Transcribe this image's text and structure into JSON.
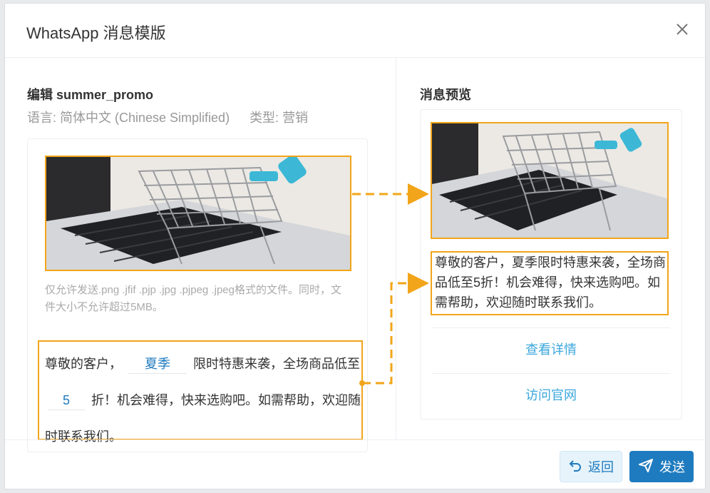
{
  "dialog": {
    "title": "WhatsApp 消息模版"
  },
  "editor": {
    "title": "编辑 summer_promo",
    "language": "语言: 简体中文 (Chinese Simplified)",
    "type": "类型: 营销",
    "upload_hint": "仅允许发送.png .jfif .pjp .jpg .pjpeg .jpeg格式的文件。同时，文件大小不允许超过5MB。",
    "body": {
      "part1": "尊敬的客户，",
      "var1": "夏季",
      "part2": "限时特惠来袭，全场商品低至",
      "var2": "5",
      "part3": "折！机会难得，快来选购吧。如需帮助，欢迎随时联系我们。"
    }
  },
  "preview": {
    "title": "消息预览",
    "message": "尊敬的客户，夏季限时特惠来袭，全场商品低至5折！机会难得，快来选购吧。如需帮助，欢迎随时联系我们。",
    "button1": "查看详情",
    "button2": "访问官网"
  },
  "footer": {
    "back_label": "返回",
    "send_label": "发送"
  },
  "colors": {
    "highlight": "#f2a51a",
    "accent": "#1f7bbf",
    "link": "#3ba7dc"
  },
  "icons": [
    "close-icon",
    "undo-icon",
    "send-icon"
  ]
}
